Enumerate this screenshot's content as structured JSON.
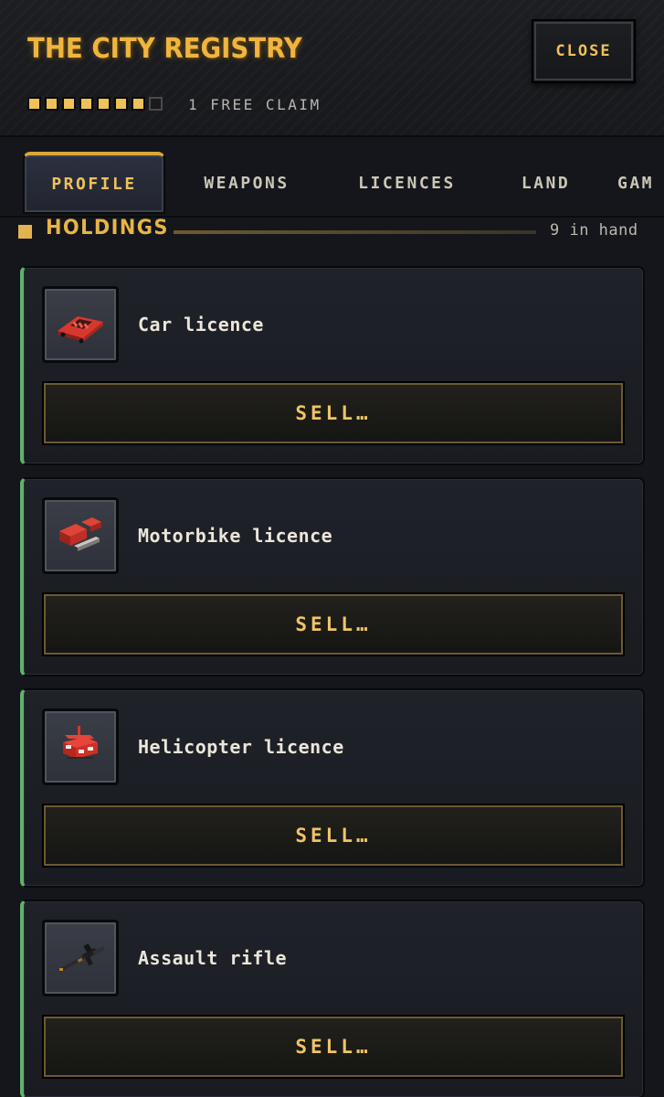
{
  "header": {
    "title": "THE CITY REGISTRY",
    "close_label": "CLOSE",
    "claims_filled": 7,
    "claims_total": 8,
    "claim_text": "1 FREE CLAIM"
  },
  "tabs": [
    {
      "label": "PROFILE",
      "active": true
    },
    {
      "label": "WEAPONS",
      "active": false
    },
    {
      "label": "LICENCES",
      "active": false
    },
    {
      "label": "LAND",
      "active": false
    },
    {
      "label": "GAM",
      "active": false
    }
  ],
  "holdings": {
    "title": "HOLDINGS",
    "count_text": "9 in hand"
  },
  "items": [
    {
      "name": "Car licence",
      "icon": "car-icon",
      "sell_label": "SELL…"
    },
    {
      "name": "Motorbike licence",
      "icon": "motorbike-icon",
      "sell_label": "SELL…"
    },
    {
      "name": "Helicopter licence",
      "icon": "helicopter-icon",
      "sell_label": "SELL…"
    },
    {
      "name": "Assault rifle",
      "icon": "assault-rifle-icon",
      "sell_label": "SELL…"
    }
  ],
  "colors": {
    "accent_gold": "#f0b53e",
    "card_stripe_green": "#5fb36a",
    "background": "#14161b"
  }
}
